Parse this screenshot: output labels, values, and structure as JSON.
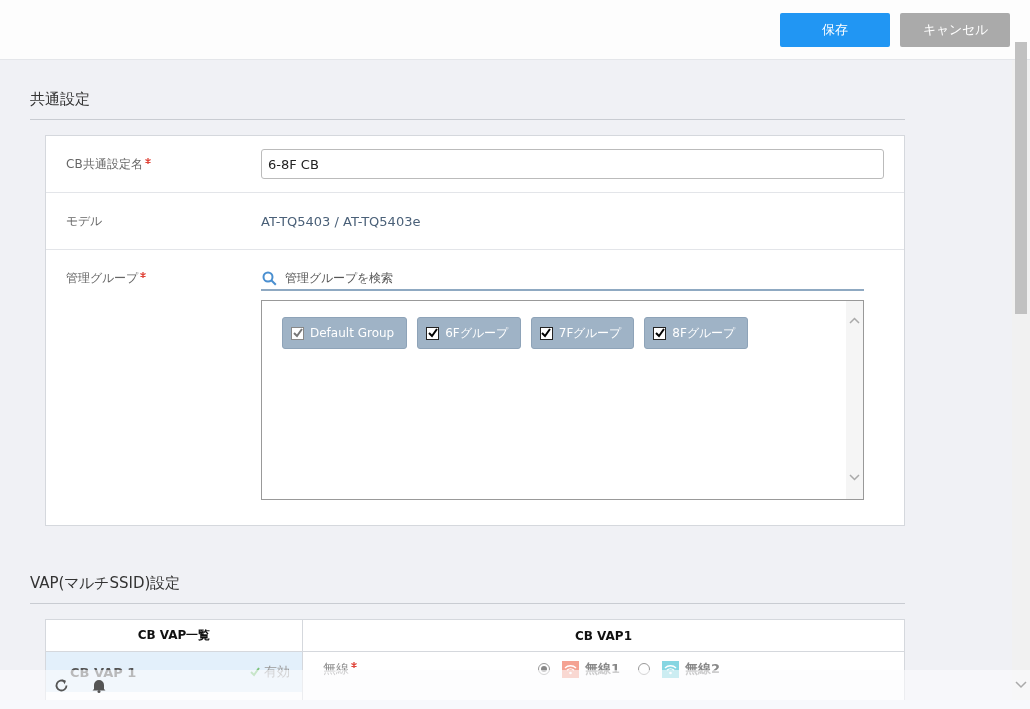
{
  "toolbar": {
    "buttons": [
      {
        "label": "保存",
        "kind": "primary"
      },
      {
        "label": "キャンセル",
        "kind": "secondary"
      }
    ]
  },
  "common": {
    "title": "共通設定",
    "name_field": {
      "label": "CB共通設定名",
      "required": true,
      "value": "6-8F CB"
    },
    "model": {
      "label": "モデル",
      "value": "AT-TQ5403 / AT-TQ5403e"
    },
    "groups": {
      "label": "管理グループ",
      "required": true,
      "search_placeholder": "管理グループを検索",
      "items": [
        {
          "label": "Default Group",
          "checked": true,
          "disabled": true
        },
        {
          "label": "6Fグループ",
          "checked": true,
          "disabled": false
        },
        {
          "label": "7Fグループ",
          "checked": true,
          "disabled": false
        },
        {
          "label": "8Fグループ",
          "checked": true,
          "disabled": false
        }
      ]
    }
  },
  "vap": {
    "title": "VAP(マルチSSID)設定",
    "list_header": "CB VAP一覧",
    "detail_header": "CB VAP1",
    "list_items": [
      {
        "name": "CB VAP 1",
        "status": "有効",
        "selected": true
      }
    ],
    "detail_fields": [
      {
        "label": "無線",
        "required": true,
        "options": [
          {
            "label": "無線1",
            "selected": true,
            "color": "#f4a292"
          },
          {
            "label": "無線2",
            "selected": false,
            "color": "#86d6e2"
          }
        ]
      }
    ]
  }
}
